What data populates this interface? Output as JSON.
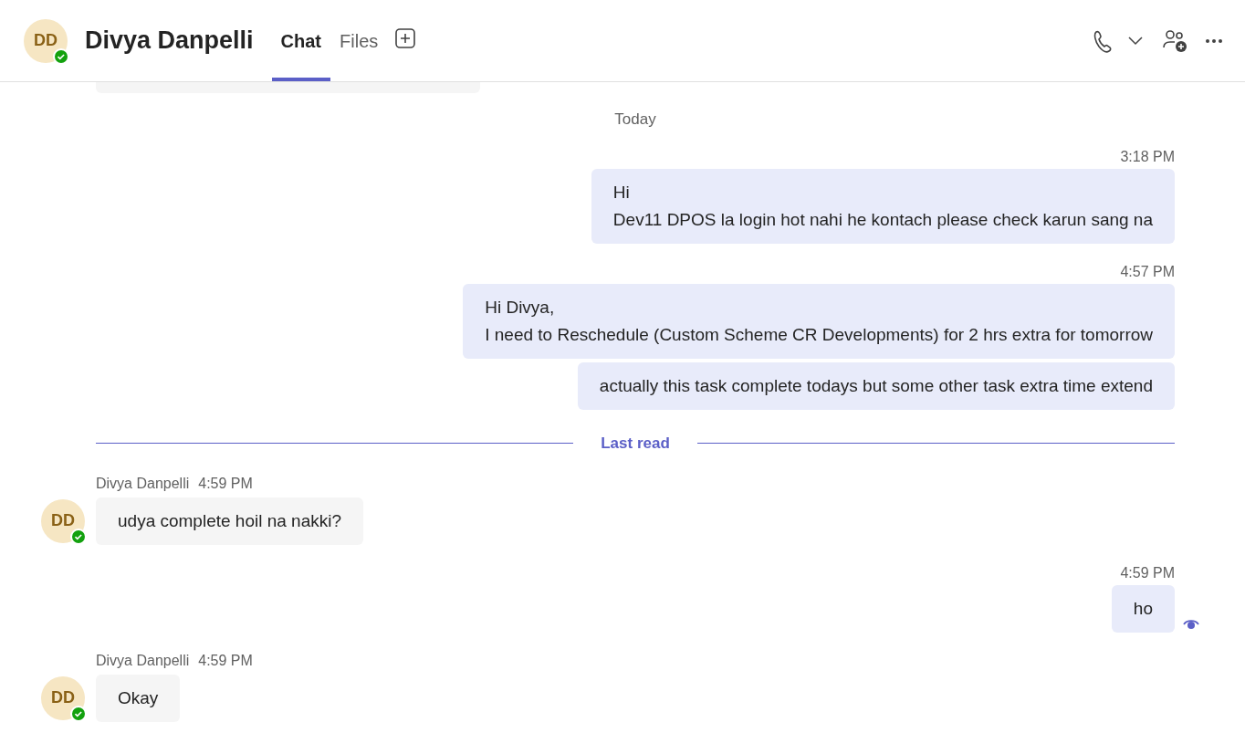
{
  "header": {
    "avatar": {
      "initials": "DD",
      "available": true
    },
    "title": "Divya Danpelli",
    "tabs": [
      {
        "label": "Chat",
        "selected": true
      },
      {
        "label": "Files",
        "selected": false
      }
    ]
  },
  "messages": [
    {
      "kind": "date",
      "text": "Today"
    },
    {
      "kind": "sent",
      "time": "3:18 PM",
      "bubbles": [
        {
          "lines": [
            "Hi",
            "Dev11 DPOS la login hot nahi he kontach please check karun sang na"
          ]
        }
      ],
      "read": false
    },
    {
      "kind": "sent",
      "time": "4:57 PM",
      "bubbles": [
        {
          "lines": [
            "Hi Divya,",
            "I need to Reschedule (Custom Scheme CR Developments) for 2 hrs extra for tomorrow"
          ]
        },
        {
          "lines": [
            "actually this task complete todays but some other task extra time extend"
          ]
        }
      ],
      "read": false
    },
    {
      "kind": "divider",
      "text": "Last read"
    },
    {
      "kind": "received",
      "sender": "Divya Danpelli",
      "time": "4:59 PM",
      "initials": "DD",
      "available": true,
      "bubbles": [
        {
          "lines": [
            "udya complete hoil na nakki?"
          ]
        }
      ]
    },
    {
      "kind": "sent",
      "time": "4:59 PM",
      "bubbles": [
        {
          "lines": [
            "ho"
          ]
        }
      ],
      "read": true
    },
    {
      "kind": "received",
      "sender": "Divya Danpelli",
      "time": "4:59 PM",
      "initials": "DD",
      "available": true,
      "bubbles": [
        {
          "lines": [
            "Okay"
          ]
        }
      ]
    }
  ]
}
